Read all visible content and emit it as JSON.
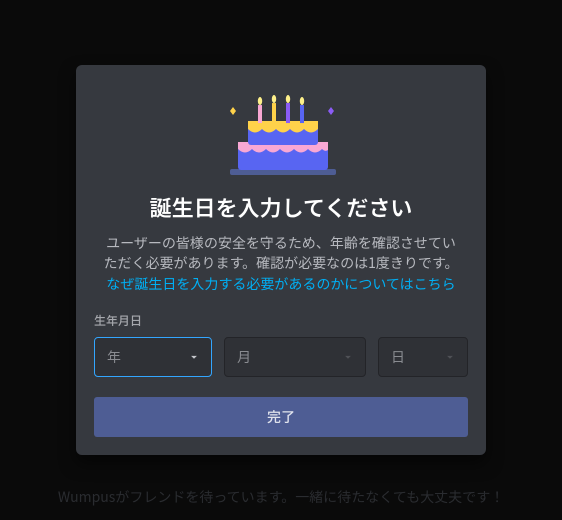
{
  "modal": {
    "title": "誕生日を入力してください",
    "desc_prefix": "ユーザーの皆様の安全を守るため、年齢を確認させていただく必要があります。確認が必要なのは1度きりです。",
    "desc_link": "なぜ誕生日を入力する必要があるのかについてはこちら",
    "field_label": "生年月日",
    "year_placeholder": "年",
    "month_placeholder": "月",
    "day_placeholder": "日",
    "done_label": "完了"
  },
  "background": {
    "text": "Wumpusがフレンドを待っています。一緒に待たなくても大丈夫です！"
  },
  "colors": {
    "modal_bg": "#36393f",
    "input_bg": "#2f3136",
    "active_border": "#33a6ff",
    "link": "#00aff4",
    "button": "#4e5d94"
  }
}
